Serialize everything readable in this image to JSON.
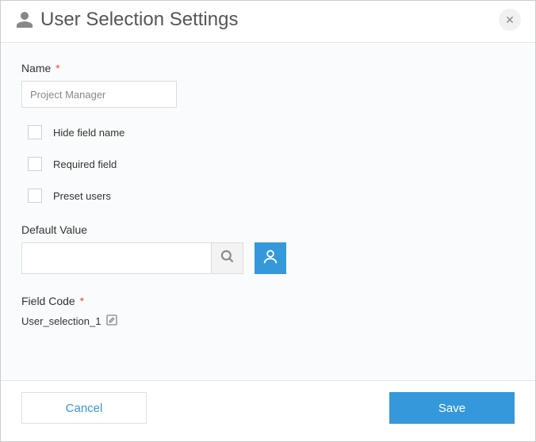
{
  "header": {
    "title": "User Selection Settings"
  },
  "form": {
    "name": {
      "label": "Name",
      "required_mark": "*",
      "value": "Project Manager"
    },
    "checkboxes": {
      "hide_field_name": "Hide field name",
      "required_field": "Required field",
      "preset_users": "Preset users"
    },
    "default_value": {
      "label": "Default Value",
      "value": ""
    },
    "field_code": {
      "label": "Field Code",
      "required_mark": "*",
      "value": "User_selection_1"
    }
  },
  "footer": {
    "cancel": "Cancel",
    "save": "Save"
  },
  "colors": {
    "accent": "#3498db"
  }
}
